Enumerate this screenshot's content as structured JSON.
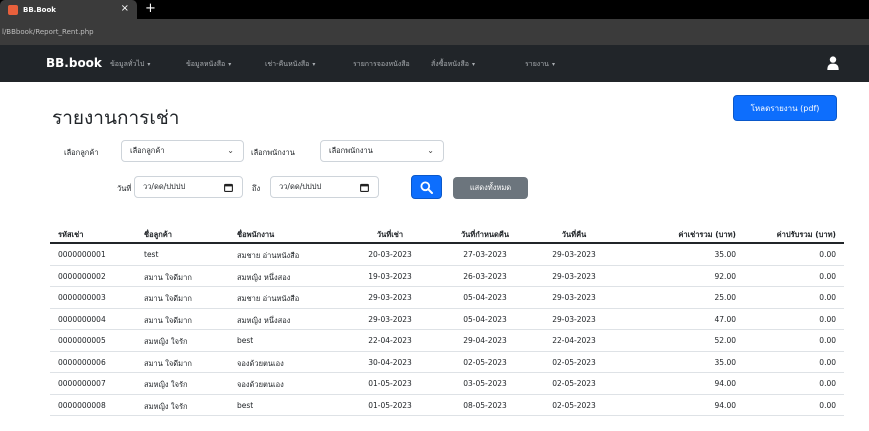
{
  "browser": {
    "tab_title": "BB.Book",
    "tab_close": "×",
    "new_tab": "+",
    "url": "l/BBbook/Report_Rent.php"
  },
  "navbar": {
    "brand": "BB.book",
    "items": [
      {
        "label": "ข้อมูลทั่วไป",
        "caret": "▾"
      },
      {
        "label": "ข้อมูลหนังสือ",
        "caret": "▾"
      },
      {
        "label": "เช่า-คืนหนังสือ",
        "caret": "▾"
      },
      {
        "label": "รายการจองหนังสือ",
        "caret": ""
      },
      {
        "label": "สั่งซื้อหนังสือ",
        "caret": "▾"
      },
      {
        "label": "รายงาน",
        "caret": "▾"
      }
    ]
  },
  "page": {
    "title": "รายงานการเช่า",
    "pdf_button": "โหลดรายงาน (pdf)"
  },
  "filters": {
    "customer_label": "เลือกลูกค้า",
    "customer_value": "เลือกลูกค้า",
    "employee_label": "เลือกพนักงาน",
    "employee_value": "เลือกพนักงาน",
    "date_label": "วันที่",
    "date_from": "วว/ดด/ปปปป",
    "to_label": "ถึง",
    "date_to": "วว/ดด/ปปปป",
    "show_all": "แสดงทั้งหมด"
  },
  "table": {
    "headers": [
      "รหัสเช่า",
      "ชื่อลูกค้า",
      "ชื่อพนักงาน",
      "วันที่เช่า",
      "วันที่กำหนดคืน",
      "วันที่คืน",
      "ค่าเช่ารวม (บาท)",
      "ค่าปรับรวม (บาท)"
    ],
    "rows": [
      [
        "0000000001",
        "test",
        "สมชาย อ่านหนังสือ",
        "20-03-2023",
        "27-03-2023",
        "29-03-2023",
        "35.00",
        "0.00"
      ],
      [
        "0000000002",
        "สมาน ใจดีมาก",
        "สมหญิง หนึ่งสอง",
        "19-03-2023",
        "26-03-2023",
        "29-03-2023",
        "92.00",
        "0.00"
      ],
      [
        "0000000003",
        "สมาน ใจดีมาก",
        "สมชาย อ่านหนังสือ",
        "29-03-2023",
        "05-04-2023",
        "29-03-2023",
        "25.00",
        "0.00"
      ],
      [
        "0000000004",
        "สมาน ใจดีมาก",
        "สมหญิง หนึ่งสอง",
        "29-03-2023",
        "05-04-2023",
        "29-03-2023",
        "47.00",
        "0.00"
      ],
      [
        "0000000005",
        "สมหญิง ใจรัก",
        "best",
        "22-04-2023",
        "29-04-2023",
        "22-04-2023",
        "52.00",
        "0.00"
      ],
      [
        "0000000006",
        "สมาน ใจดีมาก",
        "จองด้วยตนเอง",
        "30-04-2023",
        "02-05-2023",
        "02-05-2023",
        "35.00",
        "0.00"
      ],
      [
        "0000000007",
        "สมหญิง ใจรัก",
        "จองด้วยตนเอง",
        "01-05-2023",
        "03-05-2023",
        "02-05-2023",
        "94.00",
        "0.00"
      ],
      [
        "0000000008",
        "สมหญิง ใจรัก",
        "best",
        "01-05-2023",
        "08-05-2023",
        "02-05-2023",
        "94.00",
        "0.00"
      ]
    ]
  }
}
